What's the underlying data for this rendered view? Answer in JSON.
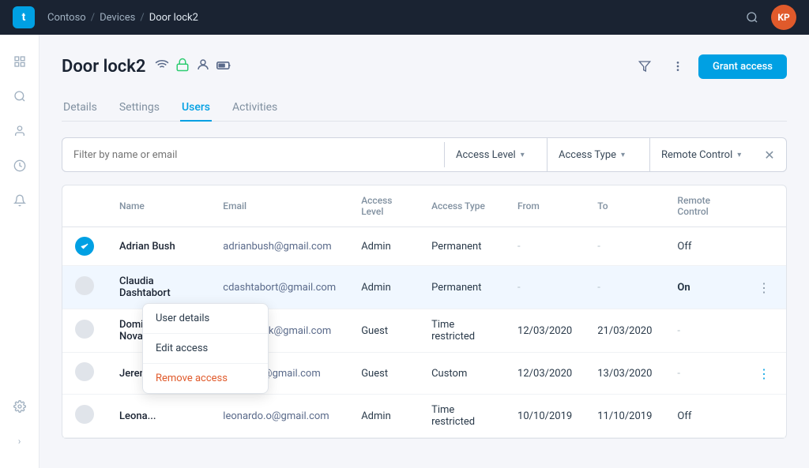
{
  "topnav": {
    "logo": "t",
    "breadcrumbs": [
      "Contoso",
      "Devices",
      "Door lock2"
    ],
    "avatar": "KP"
  },
  "sidebar": {
    "items": [
      {
        "name": "grid-icon",
        "icon": "⊞"
      },
      {
        "name": "search-nav-icon",
        "icon": "🔍"
      },
      {
        "name": "user-nav-icon",
        "icon": "👤"
      },
      {
        "name": "clock-nav-icon",
        "icon": "◷"
      },
      {
        "name": "bell-nav-icon",
        "icon": "🔔"
      },
      {
        "name": "gear-nav-icon",
        "icon": "⚙"
      }
    ],
    "expand_icon": "›"
  },
  "page": {
    "title": "Door lock2",
    "tabs": [
      "Details",
      "Settings",
      "Users",
      "Activities"
    ],
    "active_tab": "Users"
  },
  "filter_bar": {
    "search_placeholder": "Filter by name or email",
    "dropdowns": [
      {
        "label": "Access Level"
      },
      {
        "label": "Access Type"
      },
      {
        "label": "Remote Control"
      }
    ]
  },
  "table": {
    "headers": [
      "Name",
      "Email",
      "Access Level",
      "Access Type",
      "From",
      "To",
      "Remote Control"
    ],
    "rows": [
      {
        "id": 1,
        "avatar_active": true,
        "name": "Adrian Bush",
        "email": "adrianbush@gmail.com",
        "access_level": "Admin",
        "access_type": "Permanent",
        "from": "-",
        "to": "-",
        "remote_control": "Off"
      },
      {
        "id": 2,
        "avatar_active": false,
        "name": "Claudia Dashtabort",
        "email": "cdashtabort@gmail.com",
        "access_level": "Admin",
        "access_type": "Permanent",
        "from": "-",
        "to": "-",
        "remote_control": "On",
        "highlighted": true,
        "show_more": true
      },
      {
        "id": 3,
        "avatar_active": false,
        "name": "Dominic Novakowski",
        "email": "domnowak@gmail.com",
        "access_level": "Guest",
        "access_type": "Time restricted",
        "from": "12/03/2020",
        "to": "21/03/2020",
        "remote_control": "-"
      },
      {
        "id": 4,
        "avatar_active": false,
        "name": "Jeremi Strahtish",
        "email": "strahtish@gmail.com",
        "access_level": "Guest",
        "access_type": "Custom",
        "from": "12/03/2020",
        "to": "13/03/2020",
        "remote_control": "-",
        "show_more": true,
        "context_menu_open": true
      },
      {
        "id": 5,
        "avatar_active": false,
        "name": "Leona...",
        "email": "leonardo.o@gmail.com",
        "access_level": "Admin",
        "access_type": "Time restricted",
        "from": "10/10/2019",
        "to": "11/10/2019",
        "remote_control": "Off"
      }
    ]
  },
  "context_menu": {
    "items": [
      {
        "label": "User details",
        "danger": false
      },
      {
        "label": "Edit access",
        "danger": false
      },
      {
        "label": "Remove access",
        "danger": true
      }
    ]
  },
  "grant_access_btn": "Grant access"
}
